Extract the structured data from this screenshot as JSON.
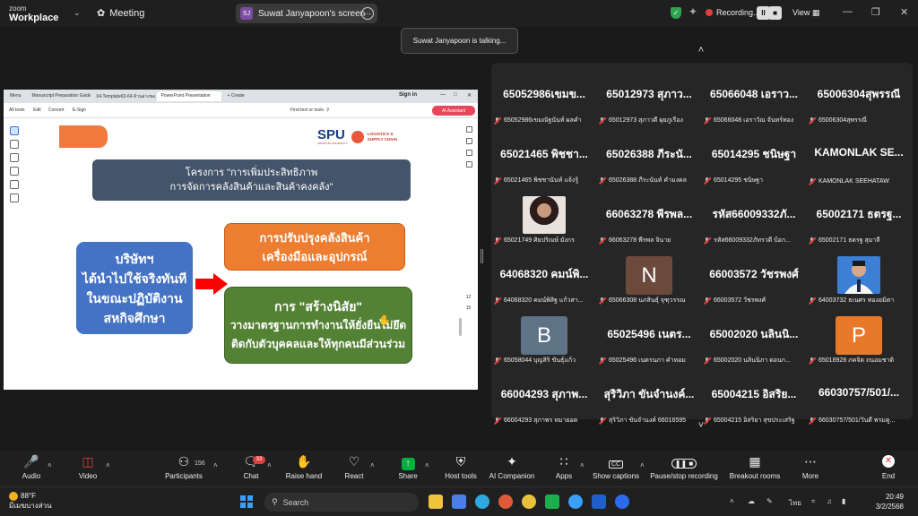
{
  "topbar": {
    "brand_small": "zoom",
    "brand_large": "Workplace",
    "meeting_label": "Meeting",
    "screen_initials": "SJ",
    "screen_label": "Suwat Janyapoon's screen",
    "recording_label": "Recording...",
    "view_label": "View"
  },
  "talking_indicator": "Suwat Janyapoon is talking...",
  "browser": {
    "tabs": [
      "Menu",
      "Manuscript Preparation Guideli...",
      "04.Template63-64 ด้านล่างของเอกสาร...",
      "PowerPoint Presentation",
      "+ Create"
    ],
    "signin": "Sign in",
    "tools": [
      "All tools",
      "Edit",
      "Convert",
      "E-Sign"
    ],
    "find": "Find text or tools",
    "ai_assistant": "AI Assistant",
    "page_current": "12",
    "page_total": "15"
  },
  "slide": {
    "logo_main": "SPU",
    "logo_sub": "SRIPATUM UNIVERSITY",
    "logo_logistics": [
      "LOGISTICS &",
      "SUPPLY CHAIN"
    ],
    "title_lines": [
      "โครงการ \"การเพิ่มประสิทธิภาพ",
      "การจัดการคลังสินค้าและสินค้าคงคลัง\""
    ],
    "left_box_lines": [
      "บริษัทฯ",
      "ได้นำไปใช้จริงทันที",
      "ในขณะปฏิบัติงาน",
      "สหกิจศึกษา"
    ],
    "orange_box_lines": [
      "การปรับปรุงคลังสินค้า",
      "เครื่องมือและอุปกรณ์"
    ],
    "green_box_lines": [
      "การ \"สร้างนิสัย\"",
      "วางมาตรฐานการทำงานให้ยั่งยืนไม่ยึด",
      "ติดกับตัวบุคคลและให้ทุกคนมีส่วนร่วม"
    ]
  },
  "participants": [
    {
      "name": "65052986เขมข...",
      "footer": "65052986เขมณัฐนันท์ ผลคำ",
      "type": "name"
    },
    {
      "name": "65012973 สุภาว...",
      "footer": "65012973 สุภาวดี ผุยภูเรือง",
      "type": "name"
    },
    {
      "name": "65066048 เอราว...",
      "footer": "65066048 เอราวัณ จันทร์ทอง",
      "type": "name"
    },
    {
      "name": "65006304สุพรรณี",
      "footer": "65006304สุพรรณี",
      "type": "name"
    },
    {
      "name": "65021465 พิชชา...",
      "footer": "65021465 พิชชานันท์ แจ้งรู้",
      "type": "name"
    },
    {
      "name": "65026388 ภีระนั...",
      "footer": "65026388 ภีระนันท์ คำมงคล",
      "type": "name"
    },
    {
      "name": "65014295 ชนิษฐา",
      "footer": "65014295 ชนิษฐา",
      "type": "name"
    },
    {
      "name": "KAMONLAK SE...",
      "footer": "KAMONLAK SEEHATAW",
      "type": "name"
    },
    {
      "name": "",
      "footer": "65021749 ศิยปริณษ์ มังกร",
      "type": "photo",
      "photo": "woman"
    },
    {
      "name": "66063278 พีรพล...",
      "footer": "66063278 พีรพล จินาย",
      "type": "name"
    },
    {
      "name": "รหัส66009332ภั...",
      "footer": "รหัส66009332ภัทรวดี บ้อก...",
      "type": "name"
    },
    {
      "name": "65002171 ธตรฐ...",
      "footer": "65002171 ธตรฐ สุมาลี",
      "type": "name"
    },
    {
      "name": "64068320 คมน์พิ...",
      "footer": "64068320 คมน์พิสิฐ แก้วสา...",
      "type": "name"
    },
    {
      "name": "",
      "footer": "65066308 นภสินธุ์ จุฑุวรรณ",
      "type": "letter",
      "letter": "N",
      "color": "#6b4a3c"
    },
    {
      "name": "66003572 วัชรพงศ์",
      "footer": "66003572 วัชรพงศ์",
      "type": "name"
    },
    {
      "name": "",
      "footer": "64003732 ธเนศร ทองอมิตา",
      "type": "photo",
      "photo": "man"
    },
    {
      "name": "",
      "footer": "65058044 บุญสิริ ขันธุ์แก้ว",
      "type": "letter",
      "letter": "B",
      "color": "#5e7386"
    },
    {
      "name": "65025496 เนตร...",
      "footer": "65025496 เนตรนภา คำหอม",
      "type": "name"
    },
    {
      "name": "65002020 นลินนิ...",
      "footer": "65002020 นลินนิภา ดอนก...",
      "type": "name"
    },
    {
      "name": "",
      "footer": "65018928 ภคจิต ถนอมชาติ",
      "type": "letter",
      "letter": "P",
      "color": "#e8782a"
    },
    {
      "name": "66004293 สุภาพ...",
      "footer": "66004293 สุภาพร หมายอด",
      "type": "name"
    },
    {
      "name": "สุริวิภา ขันจำนงค์...",
      "footer": "สุริวิภา ขันจำนงค์ 66016595",
      "type": "name"
    },
    {
      "name": "65004215 อิสริย...",
      "footer": "65004215 อิสริยา สุขประเสริฐ",
      "type": "name"
    },
    {
      "name": "66030757/501/...",
      "footer": "66030757/501/วันดี พรมคู...",
      "type": "name"
    }
  ],
  "toolbar": {
    "audio": "Audio",
    "video": "Video",
    "participants": "Participants",
    "participants_count": "156",
    "chat": "Chat",
    "chat_badge": "33",
    "raise_hand": "Raise hand",
    "react": "React",
    "share": "Share",
    "host_tools": "Host tools",
    "ai_companion": "AI Companion",
    "apps": "Apps",
    "show_captions": "Show captions",
    "pause_recording": "Pause/stop recording",
    "breakout_rooms": "Breakout rooms",
    "more": "More",
    "end": "End"
  },
  "taskbar": {
    "temperature": "88°F",
    "weather_desc": "มีเมฆบางส่วน",
    "search_placeholder": "Search",
    "language": "ไทย",
    "time": "20:49",
    "date": "3/2/2568"
  },
  "colors": {
    "accent_green": "#00b140",
    "record_red": "#e03e3e",
    "slide_title_bg": "#44546a",
    "slide_blue": "#4472c4",
    "slide_orange": "#ed7d31",
    "slide_green": "#548235"
  }
}
